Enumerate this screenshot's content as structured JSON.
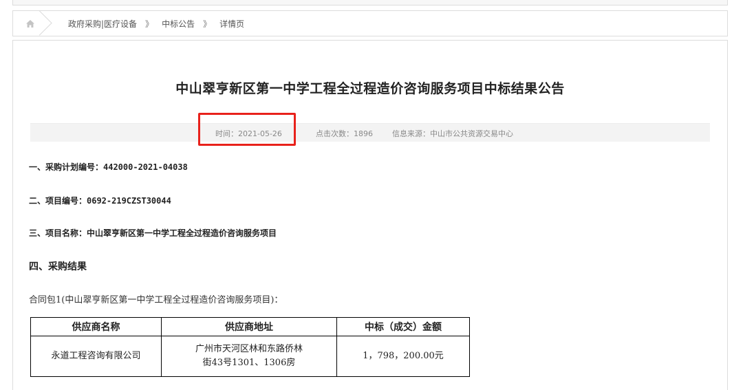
{
  "breadcrumb": {
    "home_icon": "home-icon",
    "items": [
      "政府采购|医疗设备",
      "中标公告",
      "详情页"
    ],
    "separator": "》"
  },
  "article": {
    "title": "中山翠亨新区第一中学工程全过程造价咨询服务项目中标结果公告",
    "meta": {
      "time": "时间：2021-05-26",
      "clicks": "点击次数：1896",
      "source": "信息来源：中山市公共资源交易中心"
    },
    "lines": [
      "一、采购计划编号：442000-2021-04038",
      "二、项目编号：0692-219CZST30044",
      "三、项目名称：中山翠亨新区第一中学工程全过程造价咨询服务项目"
    ],
    "section4_heading": "四、采购结果",
    "package_text": "合同包1(中山翠亨新区第一中学工程全过程造价咨询服务项目)：",
    "table": {
      "headers": [
        "供应商名称",
        "供应商地址",
        "中标（成交）金额"
      ],
      "rows": [
        {
          "name": "永道工程咨询有限公司",
          "address_line1": "广州市天河区林和东路侨林",
          "address_line2": "街43号1301、1306房",
          "amount": "1，798，200.00元"
        }
      ]
    }
  },
  "colors": {
    "highlight_border": "#e8211b",
    "meta_bar": "#f3f3f3",
    "border": "#dcdcdc"
  }
}
